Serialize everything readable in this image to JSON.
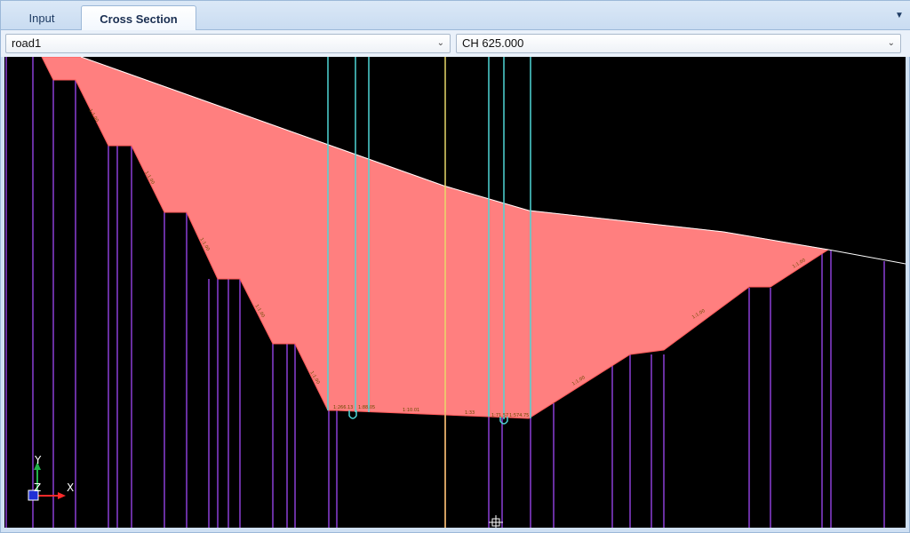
{
  "tabs": [
    {
      "label": "Input",
      "active": false
    },
    {
      "label": "Cross Section",
      "active": true
    }
  ],
  "toolbar": {
    "road_value": "road1",
    "chainage_value": "CH 625.000"
  },
  "axes": {
    "x_label": "X",
    "y_label": "Y",
    "z_label": "Z"
  },
  "colors": {
    "fill_area": "#ff7f7f",
    "offset_lines": "#8a3fd6",
    "feature_lines": "#4fd6d6",
    "centerline": "#e8d86a",
    "background": "#000000"
  },
  "icons": {
    "overflow": "chevron-down-icon",
    "dropdown": "chevron-down-icon",
    "cursor": "crosshair-cursor-icon",
    "ucs": "ucs-axes-icon"
  }
}
